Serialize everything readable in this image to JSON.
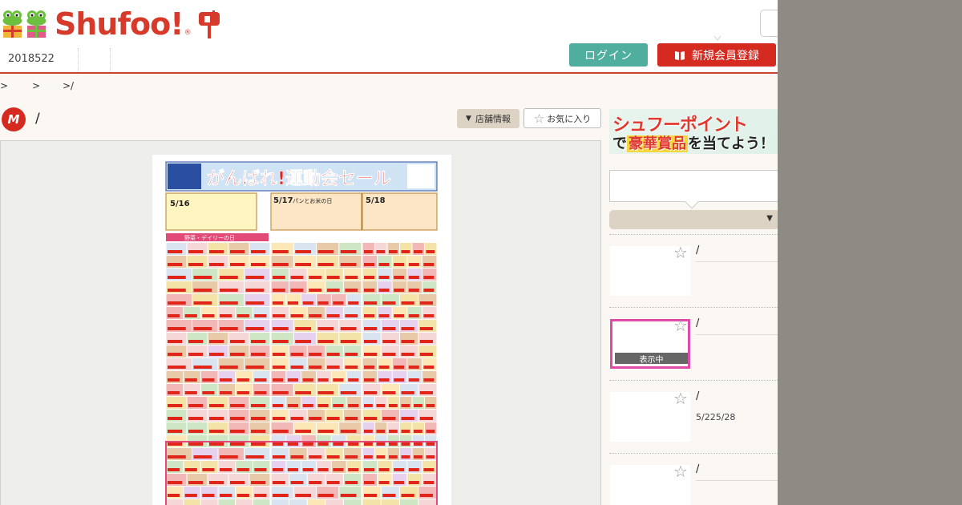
{
  "header": {
    "logo_text": "Shufoo!",
    "logo_mark": "®",
    "date_tab": "2018522",
    "login_label": "ログイン",
    "register_label": "新規会員登録"
  },
  "breadcrumb": [
    ">",
    ">",
    ">/"
  ],
  "store": {
    "icon_letter": "M",
    "name": "/",
    "info_button": "店舗情報",
    "favorite_button": "お気に入り"
  },
  "banner": {
    "line1": "シュフーポイント",
    "line2_pre": "で",
    "line2_highlight": "豪華賞品",
    "line2_post": "を当てよう！"
  },
  "sidebar": {
    "items": [
      {
        "title": "/",
        "period": "",
        "active": false
      },
      {
        "title": "/",
        "period": "",
        "active": true,
        "badge": "表示中"
      },
      {
        "title": "/",
        "period": "5/225/28",
        "active": false
      },
      {
        "title": "/",
        "period": "",
        "active": false
      }
    ]
  },
  "flyer": {
    "headline": "がんばれ!運動会セール",
    "day_labels": [
      "5/16",
      "5/17",
      "5/18"
    ],
    "section_label_1": "パンとお米の日",
    "section_label_2": "野菜・デイリーの日"
  },
  "colors": {
    "brand_red": "#d63a2a",
    "login_green": "#4fae9e",
    "register_red": "#d52a1f",
    "active_pink": "#e04aa8"
  }
}
